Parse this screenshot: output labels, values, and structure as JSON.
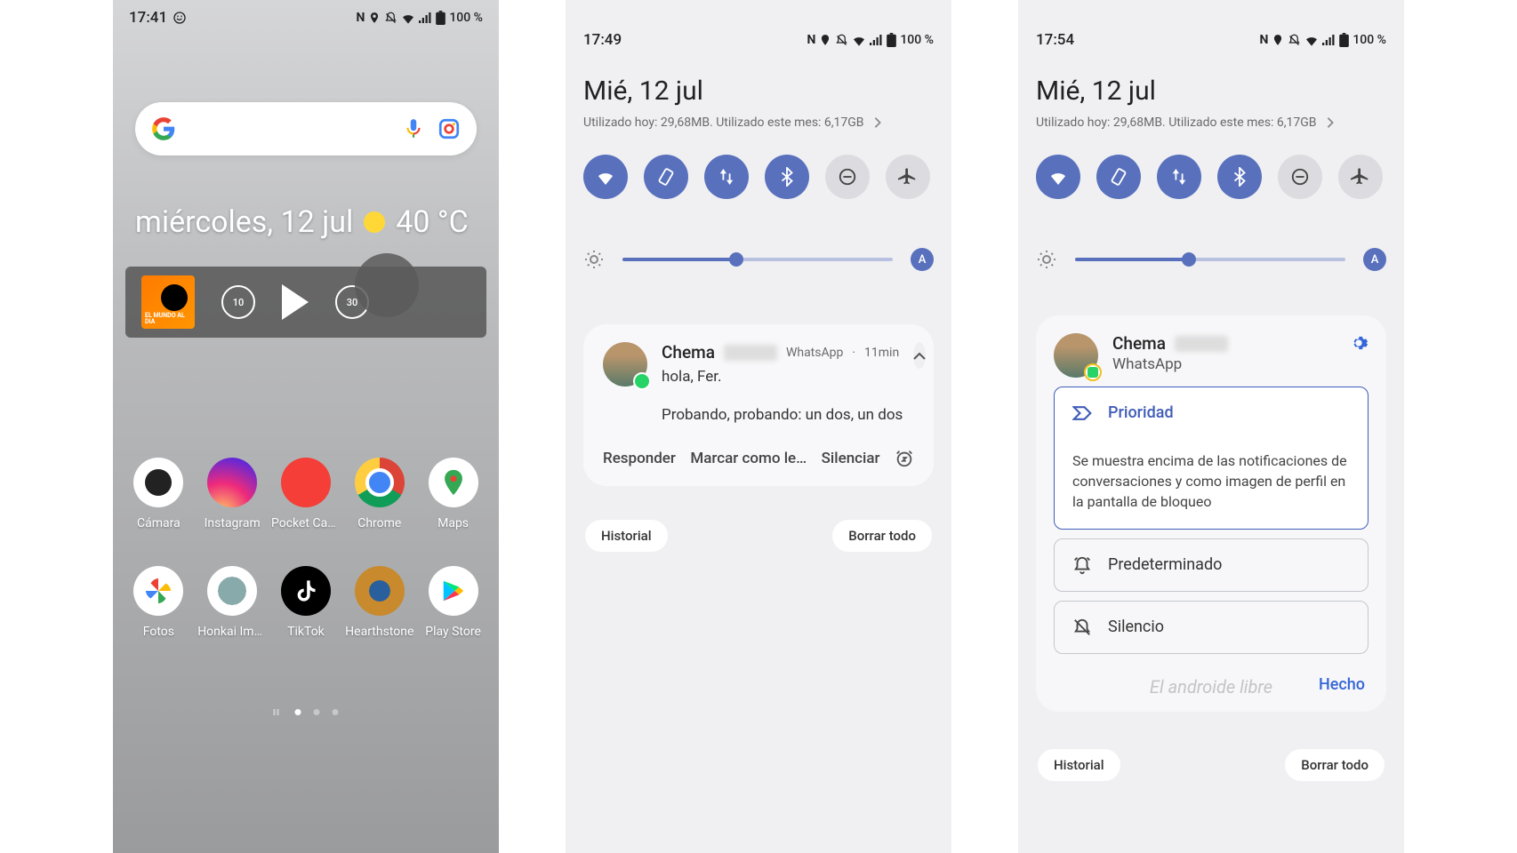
{
  "screen1": {
    "status": {
      "time": "17:41",
      "batt": "100 %"
    },
    "date_text": "miércoles, 12 jul",
    "temp": "40 °C",
    "media": {
      "art_label": "EL MUNDO AL DIA",
      "rewind": "10",
      "forward": "30"
    },
    "apps_row1": [
      {
        "label": "Cámara"
      },
      {
        "label": "Instagram"
      },
      {
        "label": "Pocket Casts"
      },
      {
        "label": "Chrome"
      },
      {
        "label": "Maps"
      }
    ],
    "apps_row2": [
      {
        "label": "Fotos"
      },
      {
        "label": "Honkai Imp…"
      },
      {
        "label": "TikTok"
      },
      {
        "label": "Hearthstone"
      },
      {
        "label": "Play Store"
      }
    ]
  },
  "screen2": {
    "status": {
      "time": "17:49",
      "batt": "100 %"
    },
    "date": "Mié, 12 jul",
    "usage": "Utilizado hoy: 29,68MB. Utilizado este mes: 6,17GB",
    "brightness_pct": 42,
    "auto_label": "A",
    "notif": {
      "name": "Chema",
      "app": "WhatsApp",
      "time": "11min",
      "dot": "·",
      "line1": "hola, Fer.",
      "line2": "Probando, probando: un dos, un dos",
      "actions": {
        "reply": "Responder",
        "mark": "Marcar como le…",
        "mute": "Silenciar"
      }
    },
    "footer": {
      "history": "Historial",
      "clear": "Borrar todo"
    }
  },
  "screen3": {
    "status": {
      "time": "17:54",
      "batt": "100 %"
    },
    "date": "Mié, 12 jul",
    "usage": "Utilizado hoy: 29,68MB. Utilizado este mes: 6,17GB",
    "brightness_pct": 42,
    "auto_label": "A",
    "notif": {
      "name": "Chema",
      "app": "WhatsApp"
    },
    "options": {
      "priority": {
        "label": "Prioridad",
        "desc": "Se muestra encima de las notificaciones de conversaciones y como imagen de perfil en la pantalla de bloqueo"
      },
      "default_label": "Predeterminado",
      "silence_label": "Silencio",
      "done": "Hecho"
    },
    "footer": {
      "history": "Historial",
      "clear": "Borrar todo"
    },
    "watermark": "El androide libre"
  }
}
